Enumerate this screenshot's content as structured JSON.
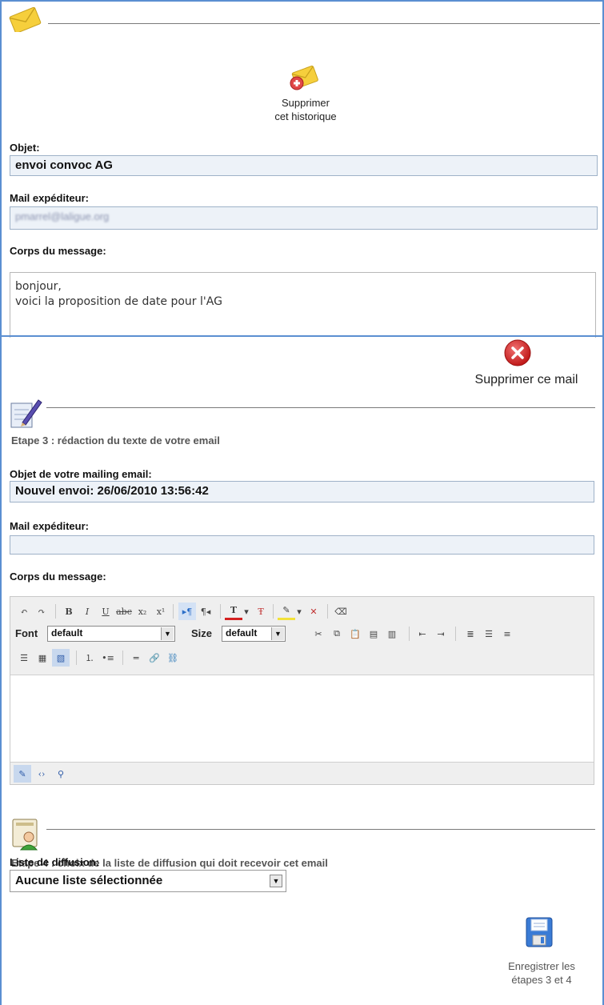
{
  "history": {
    "delete_label_line1": "Supprimer",
    "delete_label_line2": "cet historique",
    "subject_label": "Objet:",
    "subject_value": "envoi convoc AG",
    "sender_label": "Mail expéditeur:",
    "sender_value": "pmarrel@laligue.org",
    "body_label": "Corps du message:",
    "body_line1": "bonjour,",
    "body_line2": "voici la proposition de date pour l'AG"
  },
  "mail": {
    "delete_label": "Supprimer ce mail"
  },
  "step3": {
    "title": "Etape 3 : rédaction du texte de votre email",
    "subject_label": "Objet de votre mailing email:",
    "subject_value": "Nouvel envoi: 26/06/2010 13:56:42",
    "sender_label": "Mail expéditeur:",
    "sender_value": "",
    "body_label": "Corps du message:",
    "font_label": "Font",
    "font_value": "default",
    "size_label": "Size",
    "size_value": "default"
  },
  "step4": {
    "title": "Etape 4 : choix de la liste de diffusion qui doit recevoir cet email",
    "list_label": "Liste de diffusion:",
    "list_value": "Aucune liste sélectionnée"
  },
  "save": {
    "label_line1": "Enregistrer les",
    "label_line2": "étapes 3 et 4"
  },
  "colors": {
    "frame_border": "#5b8fd1",
    "field_bg": "#edf2f8",
    "delete_red": "#d42020"
  }
}
